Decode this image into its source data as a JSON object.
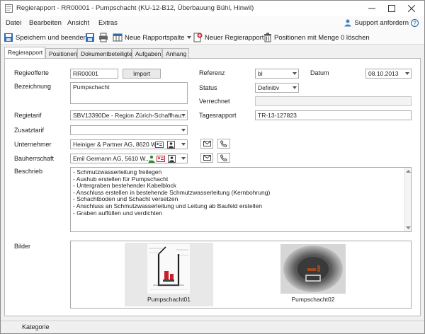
{
  "window": {
    "title": "Regierapport - RR00001 - Pumpschacht (KU-12-B12, Überbauung Bühl, Hinwil)"
  },
  "menu": {
    "items": [
      "Datei",
      "Bearbeiten",
      "Ansicht",
      "Extras"
    ],
    "support_label": "Support anfordern"
  },
  "toolbar": {
    "save_close": "Speichern und beenden",
    "new_column": "Neue Rapportspalte",
    "new_report": "Neuer Regierapport",
    "positions_zero": "Positionen mit Menge 0 löschen"
  },
  "tabs": [
    "Regierapport",
    "Positionen",
    "Dokumentbeteiligte",
    "Aufgaben",
    "Anhang"
  ],
  "form": {
    "regieofferte": {
      "label": "Regieofferte",
      "value": "RR00001",
      "button": "Import"
    },
    "bezeichnung": {
      "label": "Bezeichnung",
      "value": "Pumpschacht"
    },
    "referenz": {
      "label": "Referenz",
      "value": "bl"
    },
    "datum": {
      "label": "Datum",
      "value": "08.10.2013"
    },
    "status": {
      "label": "Status",
      "value": "Definitiv"
    },
    "verrechnet": {
      "label": "Verrechnet",
      "value": ""
    },
    "regietarif": {
      "label": "Regietarif",
      "value": "SBV13390De - Region Zürich-Schaffhau..."
    },
    "tagesrapport": {
      "label": "Tagesrapport",
      "value": "TR-13-127823"
    },
    "zusatztarif": {
      "label": "Zusatztarif",
      "value": ""
    },
    "unternehmer": {
      "label": "Unternehmer",
      "value": "Heiniger & Partner AG, 8620 W..."
    },
    "bauherrschaft": {
      "label": "Bauherrschaft",
      "value": "Emil Germann AG, 5610 W..."
    },
    "beschrieb": {
      "label": "Beschrieb",
      "lines": [
        "- Schmutzwasserleitung freilegen",
        "- Aushub erstellen für Pumpschacht",
        "- Untergraben bestehender Kabelblock",
        "- Anschluss erstellen in bestehende Schmutzwasserleitung (Kernbohrung)",
        "- Schachtboden und Schacht versetzen",
        "- Anschluss an Schmutzwasserleitung und Leitung ab Baufeld erstellen",
        "- Graben auffüllen und verdichten"
      ]
    },
    "bilder": {
      "label": "Bilder",
      "images": [
        {
          "caption": "Pumpschacht01"
        },
        {
          "caption": "Pumpschacht02"
        }
      ]
    }
  },
  "statusbar": {
    "label": "Kategorie"
  },
  "colors": {
    "accent": "#1e5fa8",
    "red": "#c8202a",
    "green": "#2e8b2e"
  }
}
